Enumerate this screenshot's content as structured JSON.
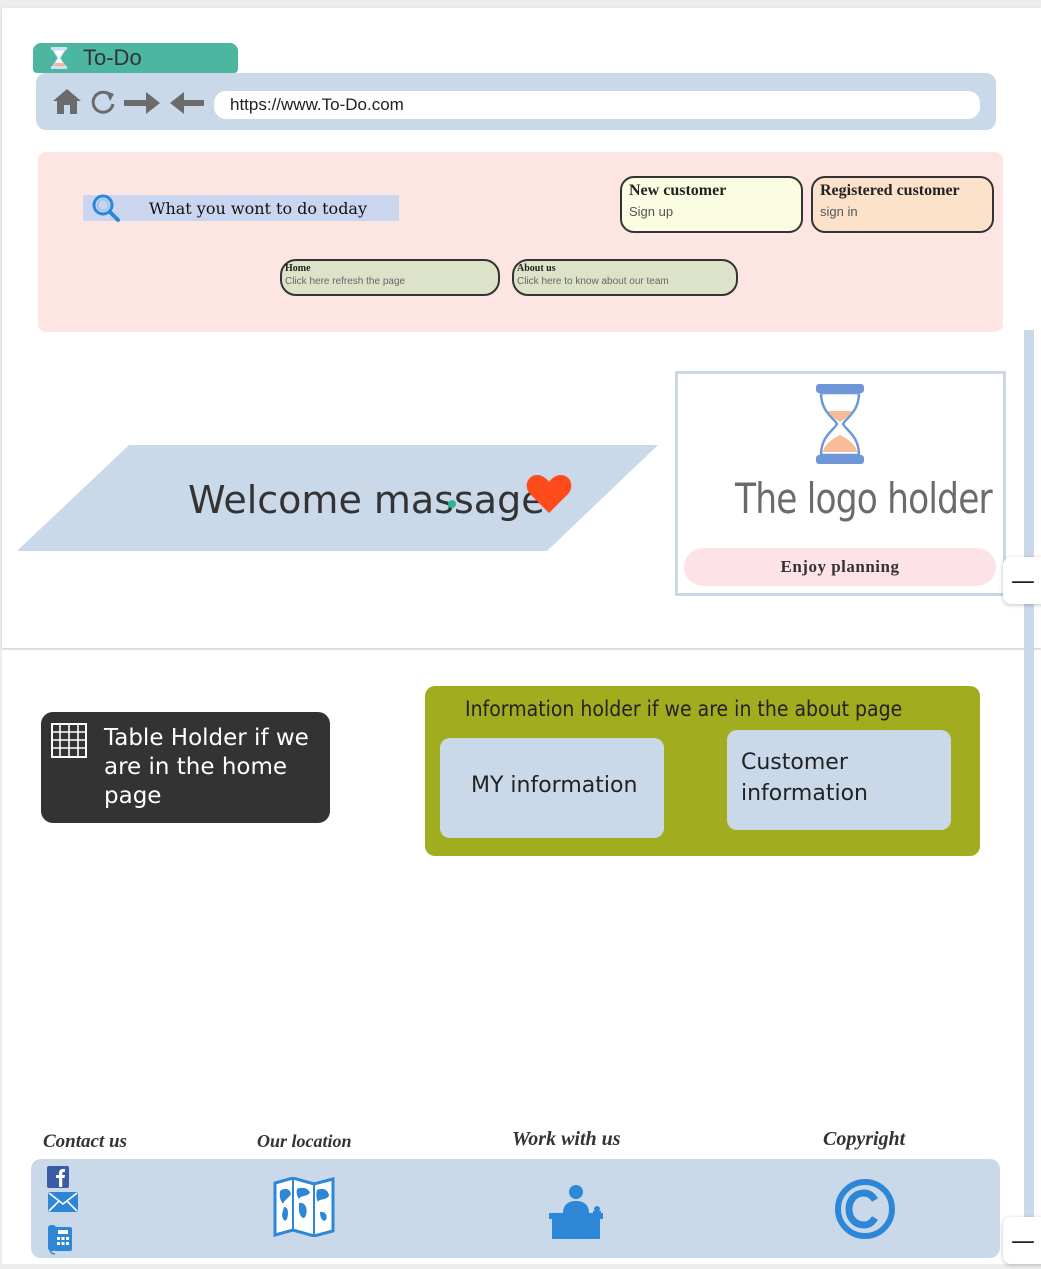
{
  "browser": {
    "tab_title": "To-Do",
    "url": "https://www.To-Do.com"
  },
  "header": {
    "search_text": "What you wont to do today",
    "new_customer": {
      "title": "New customer",
      "subtitle": "Sign up",
      "color": "#fbfde3"
    },
    "registered_customer": {
      "title": "Registered customer",
      "subtitle": "sign in",
      "color": "#fde2cb"
    },
    "nav": [
      {
        "title": "Home",
        "subtitle": "Click here refresh the page"
      },
      {
        "title": "About us",
        "subtitle": "Click here to know about our team"
      }
    ]
  },
  "welcome": {
    "text": "Welcome massage"
  },
  "logo": {
    "text": "The logo holder",
    "tagline": "Enjoy planning"
  },
  "table_holder": {
    "text": "Table Holder if we are in the home page"
  },
  "info_holder": {
    "title": "Information holder if we are in the about page",
    "my_info": "MY information",
    "customer_info": "Customer information"
  },
  "side_buttons": {
    "top": "—",
    "bottom": "—"
  },
  "footer": {
    "contact": "Contact  us",
    "location": "Our location",
    "work": "Work with us",
    "copyright": "Copyright"
  },
  "colors": {
    "accent_teal": "#4db6a0",
    "header_pink": "#fde5e3",
    "light_blue": "#cad9ea",
    "olive": "#a2ac1f",
    "heart": "#ff4a1c",
    "icon_blue": "#2e87d6"
  },
  "icons": [
    "hourglass-icon",
    "home-icon",
    "refresh-icon",
    "forward-arrow-icon",
    "back-arrow-icon",
    "search-icon",
    "heart-icon",
    "grid-table-icon",
    "facebook-icon",
    "mail-icon",
    "phone-icon",
    "map-icon",
    "desk-worker-icon",
    "copyright-icon"
  ]
}
